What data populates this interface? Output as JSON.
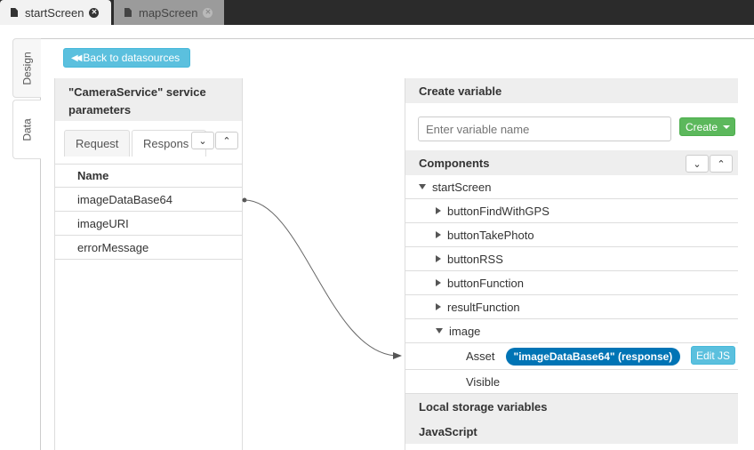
{
  "file_tabs": [
    {
      "label": "startScreen",
      "active": true
    },
    {
      "label": "mapScreen",
      "active": false
    }
  ],
  "side_tabs": {
    "design": "Design",
    "data": "Data"
  },
  "back_button": "Back to datasources",
  "service": {
    "title": "\"CameraService\" service parameters",
    "tabs": {
      "request": "Request",
      "response": "Respons"
    },
    "column_header": "Name",
    "items": [
      "imageDataBase64",
      "imageURI",
      "errorMessage"
    ]
  },
  "create_variable": {
    "title": "Create variable",
    "placeholder": "Enter variable name",
    "create_label": "Create"
  },
  "components": {
    "title": "Components",
    "root": "startScreen",
    "children": [
      "buttonFindWithGPS",
      "buttonTakePhoto",
      "buttonRSS",
      "buttonFunction",
      "resultFunction",
      "image"
    ],
    "asset_label": "Asset",
    "asset_binding": "\"imageDataBase64\" (response)",
    "edit_js": "Edit JS",
    "visible_label": "Visible"
  },
  "local_storage": "Local storage variables",
  "javascript": "JavaScript",
  "colors": {
    "accent_info": "#5bc0de",
    "success": "#5cb85c",
    "badge": "#0074b5"
  }
}
